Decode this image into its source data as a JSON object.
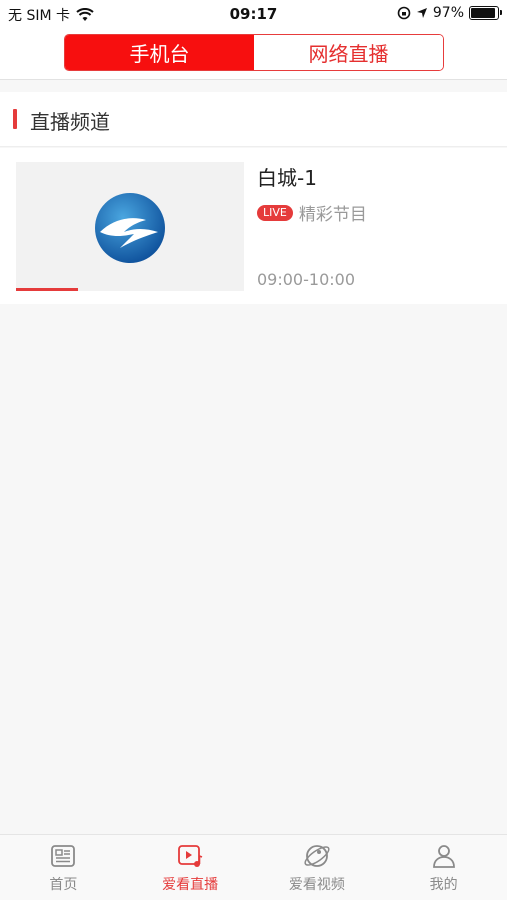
{
  "status_bar": {
    "carrier": "无 SIM 卡",
    "time": "09:17",
    "battery_percent": "97%",
    "battery_level": 0.97
  },
  "header": {
    "tabs": [
      {
        "label": "手机台",
        "active": true
      },
      {
        "label": "网络直播",
        "active": false
      }
    ]
  },
  "section": {
    "title": "直播频道"
  },
  "channels": [
    {
      "name": "白城-1",
      "live_badge": "LIVE",
      "program": "精彩节目",
      "time_range": "09:00-10:00",
      "progress": 0.27
    }
  ],
  "tabbar": {
    "items": [
      {
        "label": "首页",
        "icon": "news-icon",
        "active": false
      },
      {
        "label": "爱看直播",
        "icon": "live-video-icon",
        "active": true
      },
      {
        "label": "爱看视频",
        "icon": "planet-icon",
        "active": false
      },
      {
        "label": "我的",
        "icon": "user-icon",
        "active": false
      }
    ]
  },
  "colors": {
    "accent": "#e53b3b",
    "segment_active": "#f70f0f",
    "muted_text": "#9a9a9a"
  }
}
